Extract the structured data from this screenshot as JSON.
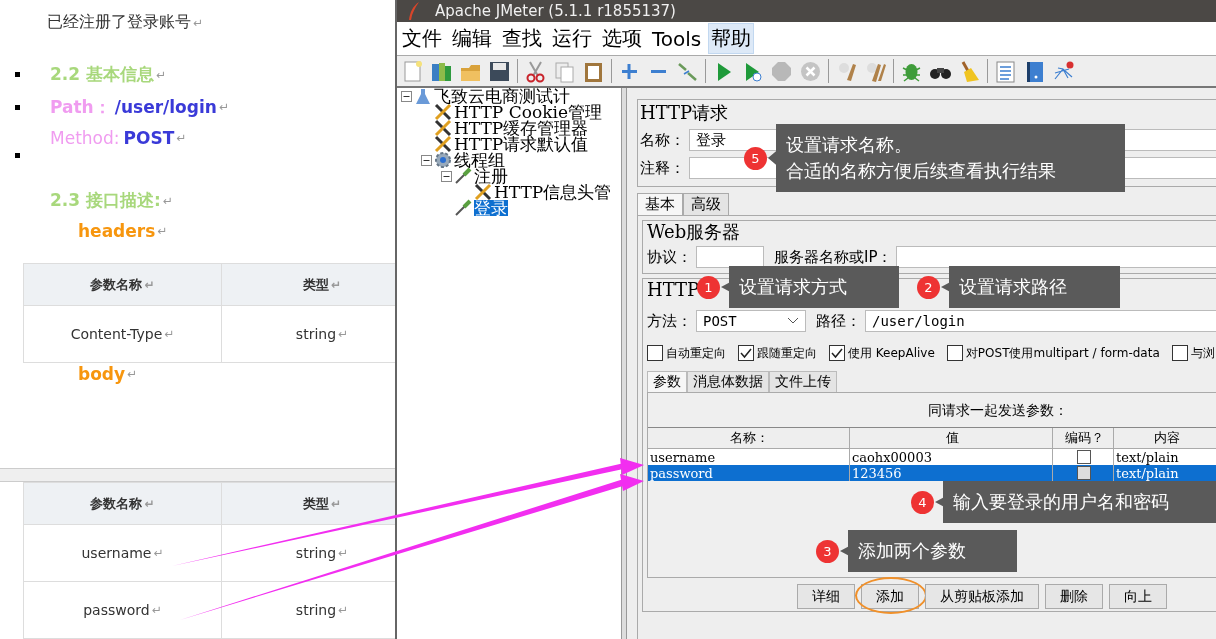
{
  "document": {
    "blocks": [
      {
        "kind": "para",
        "bullet": false,
        "text": "已经注册了登录账号",
        "mark": "↵"
      },
      {
        "kind": "heading",
        "bullet": true,
        "text": "2.2 基本信息",
        "mark": "↵"
      },
      {
        "kind": "field",
        "bullet": true,
        "label": "Path：",
        "label_bold": true,
        "value": "/user/login",
        "mark": "↵"
      },
      {
        "kind": "field",
        "bullet": false,
        "label": "Method: ",
        "label_bold": false,
        "value": "POST",
        "mark": "↵"
      },
      {
        "kind": "blank",
        "bullet": true
      },
      {
        "kind": "heading",
        "bullet": false,
        "text": "2.3 接口描述:",
        "mark": "↵"
      },
      {
        "kind": "sublabel",
        "bullet": false,
        "text": "headers",
        "mark": "↵"
      },
      {
        "kind": "table",
        "columns": [
          {
            "text": "参数名称",
            "mark": "↵"
          },
          {
            "text": "类型",
            "mark": "↵"
          }
        ],
        "rows": [
          [
            {
              "text": "Content-Type",
              "mark": "↵"
            },
            {
              "text": "string",
              "mark": "↵"
            }
          ]
        ]
      },
      {
        "kind": "sublabel",
        "bullet": false,
        "text": "body",
        "mark": "↵"
      },
      {
        "kind": "break"
      },
      {
        "kind": "table",
        "columns": [
          {
            "text": "参数名称",
            "mark": "↵"
          },
          {
            "text": "类型",
            "mark": "↵"
          }
        ],
        "rows": [
          [
            {
              "text": "username",
              "mark": "↵"
            },
            {
              "text": "string",
              "mark": "↵"
            }
          ],
          [
            {
              "text": "password",
              "mark": "↵"
            },
            {
              "text": "string",
              "mark": "↵"
            }
          ]
        ]
      }
    ]
  },
  "jmeter": {
    "title": "Apache JMeter (5.1.1 r1855137)",
    "menu": [
      {
        "label": "文件",
        "selected": false
      },
      {
        "label": "编辑",
        "selected": false
      },
      {
        "label": "查找",
        "selected": false
      },
      {
        "label": "运行",
        "selected": false
      },
      {
        "label": "选项",
        "selected": false
      },
      {
        "label": "Tools",
        "selected": false
      },
      {
        "label": "帮助",
        "selected": true
      }
    ],
    "tree": [
      {
        "label": "飞致云电商测试计",
        "kind": "plan",
        "expanded": true,
        "selected": false,
        "children": [
          {
            "label": "HTTP Cookie管理",
            "kind": "config",
            "selected": false
          },
          {
            "label": "HTTP缓存管理器",
            "kind": "config",
            "selected": false
          },
          {
            "label": "HTTP请求默认值",
            "kind": "config",
            "selected": false
          },
          {
            "label": "线程组",
            "kind": "threadgroup",
            "expanded": true,
            "selected": false,
            "children": [
              {
                "label": "注册",
                "kind": "sampler",
                "expanded": true,
                "selected": false,
                "children": [
                  {
                    "label": "HTTP信息头管",
                    "kind": "config",
                    "selected": false
                  }
                ]
              },
              {
                "label": "登录",
                "kind": "sampler",
                "selected": true
              }
            ]
          }
        ]
      }
    ],
    "panel_title": "HTTP请求",
    "name_label": "名称：",
    "name_value": "登录",
    "comment_label": "注释：",
    "tabs": [
      {
        "label": "基本",
        "selected": true
      },
      {
        "label": "高级",
        "selected": false
      }
    ],
    "web_server": {
      "title": "Web服务器",
      "protocol_label": "协议：",
      "server_label": "服务器名称或IP："
    },
    "http_group_title": "HTTP",
    "method_label": "方法：",
    "method_value": "POST",
    "path_label": "路径：",
    "path_value": "/user/login",
    "options": [
      {
        "label": "自动重定向",
        "checked": false
      },
      {
        "label": "跟随重定向",
        "checked": true
      },
      {
        "label": "使用 KeepAlive",
        "checked": true
      },
      {
        "label": "对POST使用multipart / form-data",
        "checked": false
      },
      {
        "label": "与浏",
        "checked": false
      }
    ],
    "sub_tabs": [
      {
        "label": "参数",
        "selected": true
      },
      {
        "label": "消息体数据",
        "selected": false
      },
      {
        "label": "文件上传",
        "selected": false
      }
    ],
    "params_caption": "同请求一起发送参数：",
    "columns": [
      "名称：",
      "值",
      "编码？",
      "内容"
    ],
    "rows": [
      {
        "name": "username",
        "value": "caohx00003",
        "encode": false,
        "content_type": "text/plain",
        "selected": false
      },
      {
        "name": "password",
        "value": "123456",
        "encode": false,
        "content_type": "text/plain",
        "selected": true
      }
    ],
    "buttons": [
      {
        "label": "详细",
        "circled": false
      },
      {
        "label": "添加",
        "circled": true
      },
      {
        "label": "从剪贴板添加",
        "circled": false
      },
      {
        "label": "删除",
        "circled": false
      },
      {
        "label": "向上",
        "circled": false
      }
    ]
  },
  "annotations": [
    {
      "number": "5",
      "lines": [
        "设置请求名称。",
        "合适的名称方便后续查看执行结果"
      ]
    },
    {
      "number": "1",
      "lines": [
        "设置请求方式"
      ]
    },
    {
      "number": "2",
      "lines": [
        "设置请求路径"
      ]
    },
    {
      "number": "4",
      "lines": [
        "输入要登录的用户名和密码"
      ]
    },
    {
      "number": "3",
      "lines": [
        "添加两个参数"
      ]
    }
  ]
}
